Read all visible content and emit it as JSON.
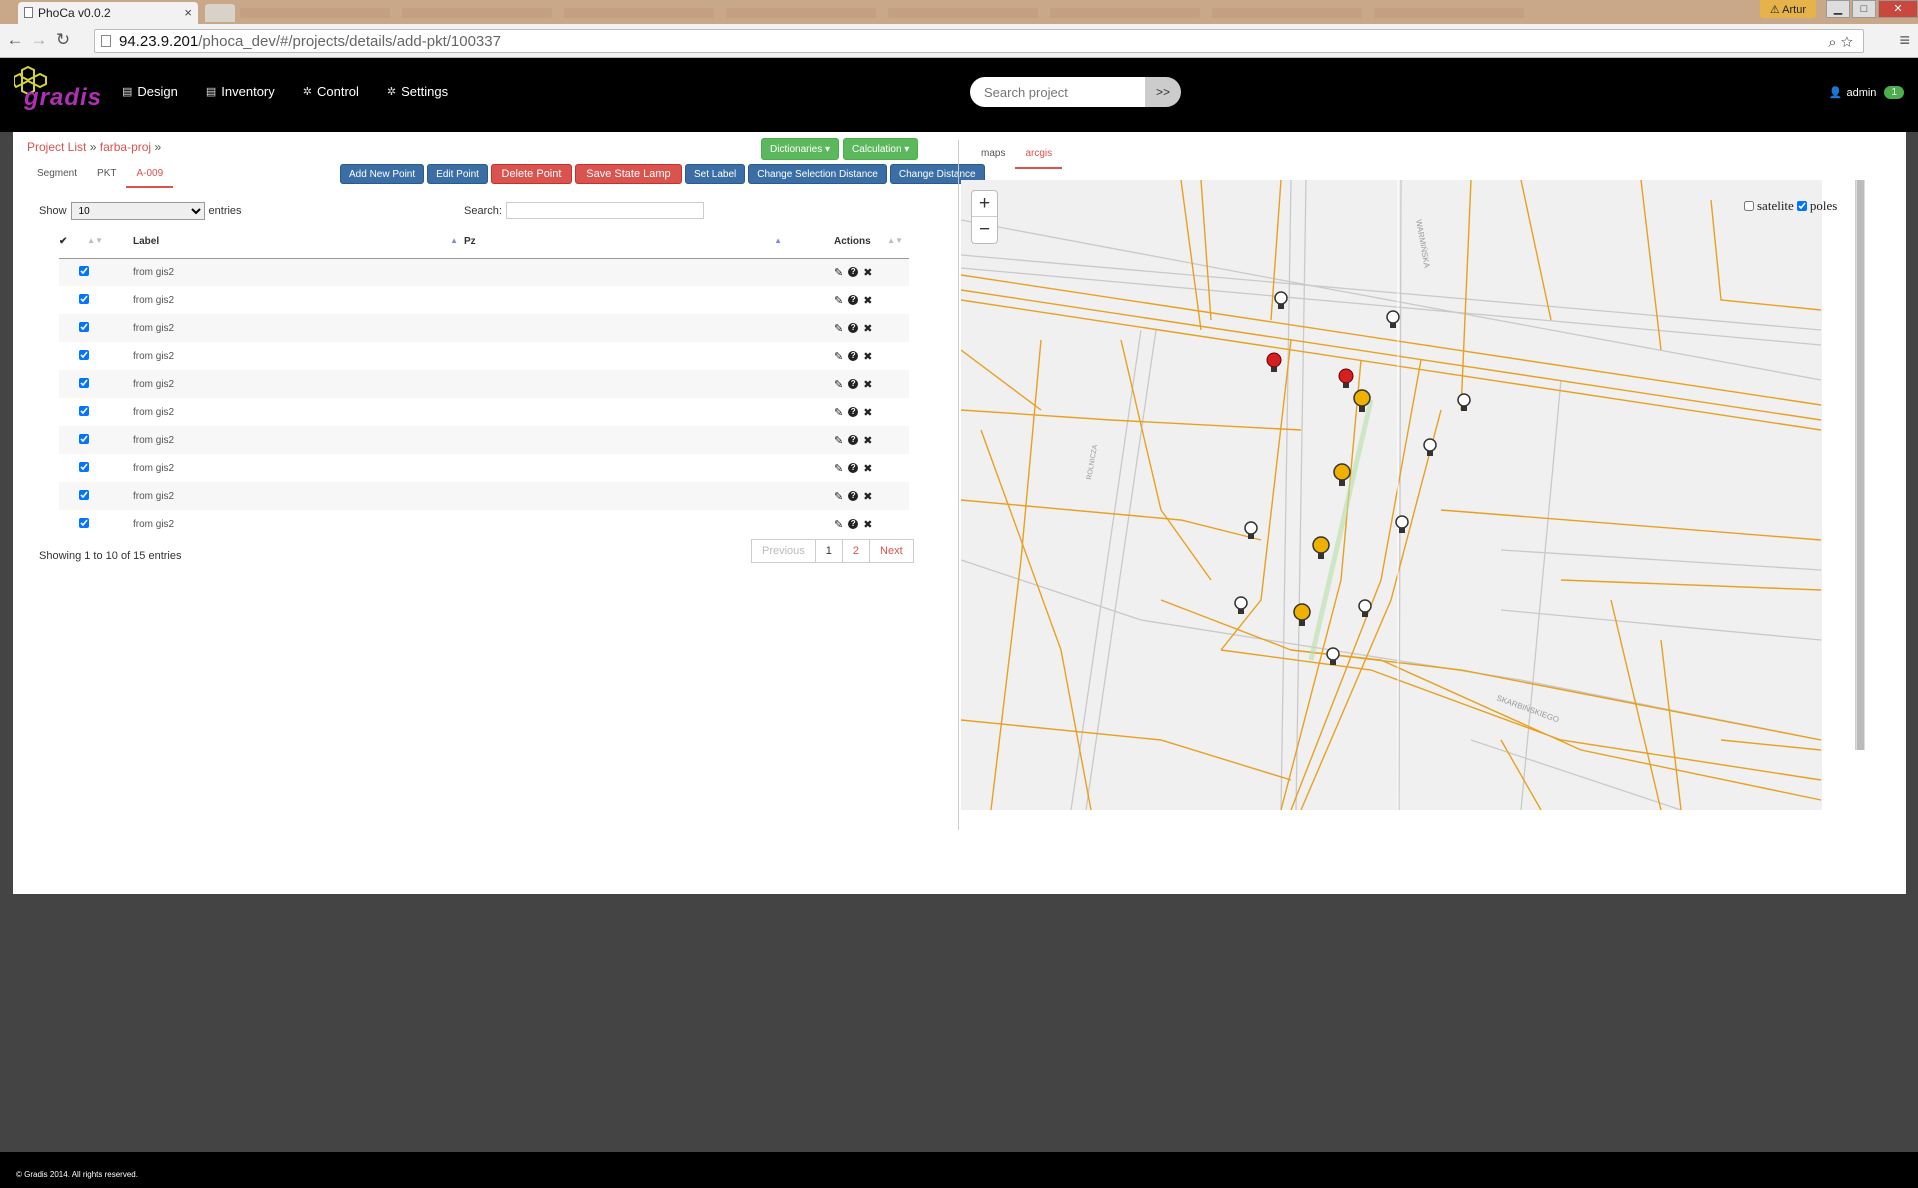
{
  "browser": {
    "tab_title": "PhoCa v0.0.2",
    "user": "Artur",
    "url_host": "94.23.9.201",
    "url_path": "/phoca_dev/#/projects/details/add-pkt/100337"
  },
  "header": {
    "logo_text": "gradis",
    "nav": [
      {
        "label": "Design",
        "icon": "list-icon"
      },
      {
        "label": "Inventory",
        "icon": "list-icon"
      },
      {
        "label": "Control",
        "icon": "gear-icon"
      },
      {
        "label": "Settings",
        "icon": "gear-icon"
      }
    ],
    "search_placeholder": "Search project",
    "search_go": ">>",
    "user": "admin",
    "user_badge": "1"
  },
  "breadcrumb": {
    "root": "Project List",
    "sep": "»",
    "project": "farba-proj"
  },
  "sub_tabs": [
    "Segment",
    "PKT",
    "A-009"
  ],
  "toolbar": {
    "dictionaries": "Dictionaries ▾",
    "calculation": "Calculation ▾",
    "add_new_point": "Add New Point",
    "edit_point": "Edit Point",
    "delete_point": "Delete Point",
    "save_state_lamp": "Save State Lamp",
    "set_label": "Set Label",
    "change_selection_distance": "Change Selection Distance",
    "change_distance": "Change Distance"
  },
  "table_controls": {
    "show": "Show",
    "show_value": "10",
    "entries": "entries",
    "search_label": "Search:"
  },
  "table": {
    "columns": [
      "Label",
      "Pz",
      "Actions"
    ],
    "rows": [
      {
        "label": "from gis2",
        "pz": ""
      },
      {
        "label": "from gis2",
        "pz": ""
      },
      {
        "label": "from gis2",
        "pz": ""
      },
      {
        "label": "from gis2",
        "pz": ""
      },
      {
        "label": "from gis2",
        "pz": ""
      },
      {
        "label": "from gis2",
        "pz": ""
      },
      {
        "label": "from gis2",
        "pz": ""
      },
      {
        "label": "from gis2",
        "pz": ""
      },
      {
        "label": "from gis2",
        "pz": ""
      },
      {
        "label": "from gis2",
        "pz": ""
      }
    ],
    "info": "Showing 1 to 10 of 15 entries",
    "pager": {
      "previous": "Previous",
      "pages": [
        "1",
        "2"
      ],
      "current": "2",
      "next": "Next"
    }
  },
  "map": {
    "tabs": [
      "maps",
      "arcgis"
    ],
    "active_tab": "arcgis",
    "zoom_in": "+",
    "zoom_out": "−",
    "layers": {
      "satelite": "satelite",
      "poles": "poles"
    },
    "street_labels": [
      "WARMIŃSKA",
      "SKARBIŃSKIEGO",
      "ROLNICZA"
    ],
    "colors": {
      "network": "#e8a020",
      "streets": "#c8c8c8",
      "lamp_red": "#d42020",
      "lamp_yellow": "#f0b000"
    }
  },
  "footer": "© Gradis 2014. All rights reserved."
}
